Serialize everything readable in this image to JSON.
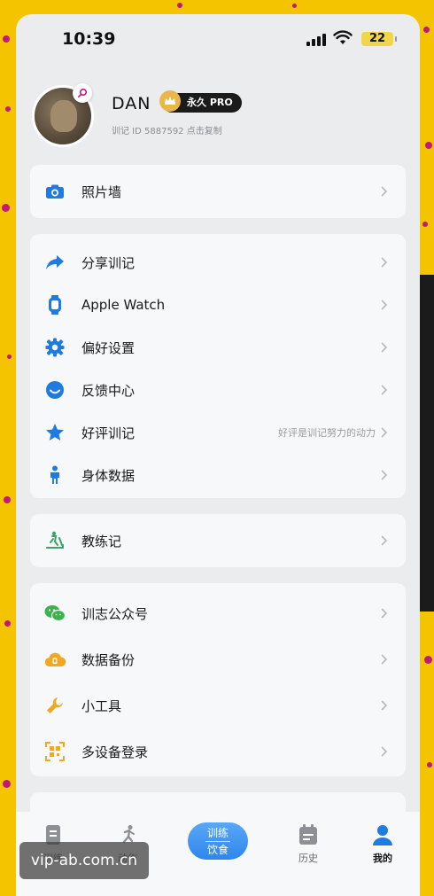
{
  "status_bar": {
    "time": "10:39",
    "battery": "22"
  },
  "profile": {
    "username": "DAN",
    "badge": "永久 PRO",
    "user_id": "训记 ID 5887592 点击复制"
  },
  "sections": [
    {
      "items": [
        {
          "label": "照片墙",
          "icon": "camera-icon"
        }
      ]
    },
    {
      "items": [
        {
          "label": "分享训记",
          "icon": "share-icon"
        },
        {
          "label": "Apple Watch",
          "icon": "watch-icon"
        },
        {
          "label": "偏好设置",
          "icon": "gear-icon"
        },
        {
          "label": "反馈中心",
          "icon": "smile-icon"
        },
        {
          "label": "好评训记",
          "icon": "star-icon",
          "hint": "好评是训记努力的动力"
        },
        {
          "label": "身体数据",
          "icon": "person-icon"
        }
      ]
    },
    {
      "items": [
        {
          "label": "教练记",
          "icon": "treadmill-icon"
        }
      ]
    },
    {
      "items": [
        {
          "label": "训志公众号",
          "icon": "wechat-icon"
        },
        {
          "label": "数据备份",
          "icon": "backup-icon"
        },
        {
          "label": "小工具",
          "icon": "wrench-icon"
        },
        {
          "label": "多设备登录",
          "icon": "qr-icon"
        }
      ]
    }
  ],
  "tabbar": {
    "tabs": [
      {
        "label": "训练",
        "icon": "document-icon"
      },
      {
        "label": "动作",
        "icon": "run-icon"
      },
      {
        "label": "历史",
        "icon": "calendar-icon"
      },
      {
        "label": "我的",
        "icon": "user-icon"
      }
    ],
    "center_top": "训练",
    "center_bottom": "饮食"
  },
  "watermark": "vip-ab.com.cn",
  "colors": {
    "accent": "#2f86ea",
    "border_bg": "#f5c400",
    "dot": "#c2187a"
  }
}
